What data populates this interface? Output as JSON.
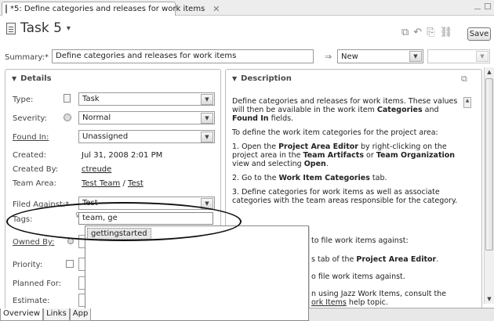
{
  "tab": {
    "title": "*5: Define categories and releases for work items",
    "close": "✕"
  },
  "header": {
    "title": "Task 5",
    "caret": "▾",
    "save_label": "Save"
  },
  "tools": [
    "compare-icon",
    "back-icon",
    "attach-icon",
    "link-icon"
  ],
  "summary": {
    "label": "Summary:*",
    "value": "Define categories and releases for work items",
    "state_arrow": "⇒",
    "state": "New",
    "resolution": ""
  },
  "details": {
    "heading": "Details",
    "type": {
      "label": "Type:",
      "value": "Task"
    },
    "severity": {
      "label": "Severity:",
      "value": "Normal"
    },
    "found_in": {
      "label": "Found In:",
      "value": "Unassigned"
    },
    "created": {
      "label": "Created:",
      "value": "Jul 31, 2008 2:01 PM"
    },
    "created_by": {
      "label": "Created By:",
      "value": "ctreude"
    },
    "team_area": {
      "label": "Team Area:",
      "value": "Test Team",
      "sep": " / ",
      "value2": "Test"
    },
    "filed_against": {
      "label": "Filed Against:*",
      "value": "Test"
    },
    "tags": {
      "label": "Tags:",
      "value": "team, ge",
      "suggestion": "gettingstarted"
    },
    "owned_by": {
      "label": "Owned By:"
    },
    "priority": {
      "label": "Priority:"
    },
    "planned_for": {
      "label": "Planned For:"
    },
    "estimate": {
      "label": "Estimate:"
    }
  },
  "description": {
    "heading": "Description",
    "p1a": "Define categories and releases for work items. These values will then be available in the work item ",
    "p1b": "Categories",
    "p1c": " and ",
    "p1d": "Found In",
    "p1e": " fields.",
    "p2": "To define the work item categories for the project area:",
    "p3a": "1. Open the ",
    "p3b": "Project Area Editor",
    "p3c": " by right-clicking on the project area in the ",
    "p3d": "Team Artifacts",
    "p3e": " or ",
    "p3f": "Team Organization",
    "p3g": " view and selecting ",
    "p3h": "Open",
    "p3i": ".",
    "p4a": "2. Go to the ",
    "p4b": "Work Item Categories",
    "p4c": " tab.",
    "p5": "3. Define categories for work items as well as associate categories with the team areas responsible for the category.",
    "f1": "to file work items against:",
    "f2a": "s tab of the ",
    "f2b": "Project Area Editor",
    "f2c": ".",
    "f3": "o file work items against.",
    "f4a": "n using Jazz Work Items, consult the",
    "f4b": "ork Items",
    "f4c": " help topic."
  },
  "bottom_tabs": [
    "Overview",
    "Links",
    "App"
  ]
}
